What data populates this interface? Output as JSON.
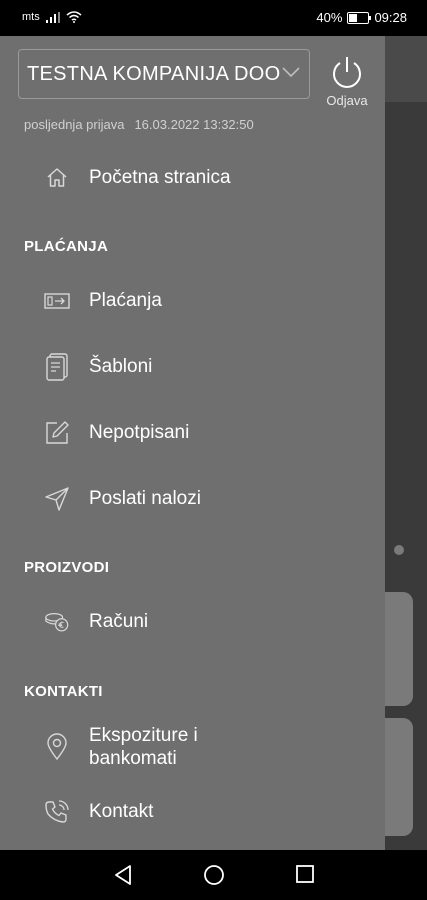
{
  "status_bar": {
    "carrier": "mts",
    "battery": "40%",
    "battery_level": 0.4,
    "time": "09:28"
  },
  "drawer": {
    "company_name": "TESTNA KOMPANIJA DOO",
    "logout_label": "Odjava",
    "last_login_label": "posljednja prijava",
    "last_login_time": "16.03.2022 13:32:50",
    "home": {
      "label": "Početna stranica",
      "icon": "home-icon"
    },
    "sections": {
      "payments": "PLAĆANJA",
      "products": "PROIZVODI",
      "contacts": "KONTAKTI"
    },
    "items": {
      "payments": {
        "label": "Plaćanja",
        "icon": "payment-card-icon"
      },
      "templates": {
        "label": "Šabloni",
        "icon": "template-document-icon"
      },
      "unsigned": {
        "label": "Nepotpisani",
        "icon": "edit-pencil-icon"
      },
      "sent": {
        "label": "Poslati nalozi",
        "icon": "send-icon"
      },
      "accounts": {
        "label": "Računi",
        "icon": "coins-icon"
      },
      "branches": {
        "label_line1": "Ekspoziture i",
        "label_line2": "bankomati",
        "icon": "location-pin-icon"
      },
      "contact": {
        "label": "Kontakt",
        "icon": "phone-icon"
      }
    }
  },
  "colors": {
    "drawer_bg": "#6f6f6f",
    "overlay_bg": "#3a3a3a",
    "text": "#ffffff"
  }
}
